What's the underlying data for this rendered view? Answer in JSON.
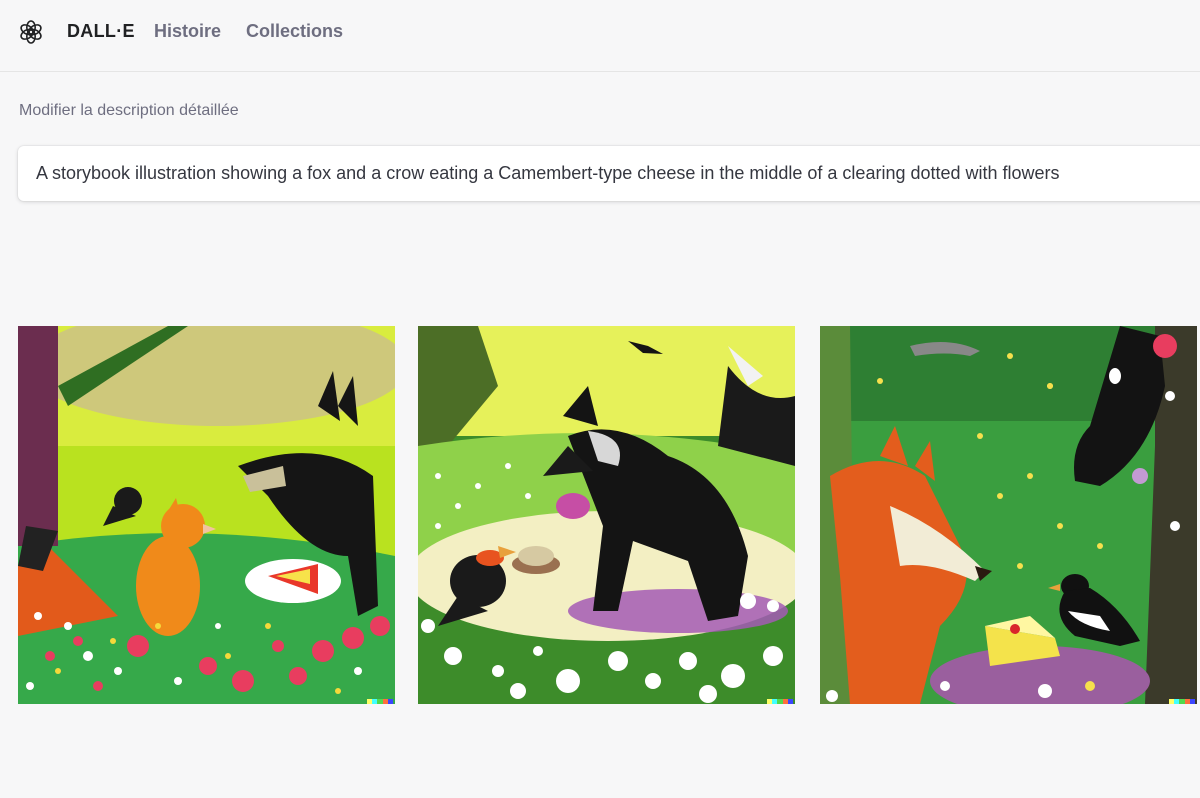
{
  "header": {
    "logo_icon": "openai-logo-icon",
    "nav": [
      {
        "label": "DALL·E"
      },
      {
        "label": "Histoire"
      },
      {
        "label": "Collections"
      }
    ]
  },
  "prompt": {
    "label": "Modifier la description détaillée",
    "value": "A storybook illustration showing a fox and a crow eating a Camembert-type cheese in the middle of a clearing dotted with flowers"
  },
  "results": [
    {
      "name": "generated-image-1"
    },
    {
      "name": "generated-image-2"
    },
    {
      "name": "generated-image-3"
    }
  ],
  "colors": {
    "background": "#f7f7f8",
    "text_primary": "#202123",
    "text_secondary": "#6e6e80",
    "signature": [
      "#ffff66",
      "#42ffff",
      "#51da4c",
      "#ff6e3c",
      "#3c46ff"
    ]
  }
}
